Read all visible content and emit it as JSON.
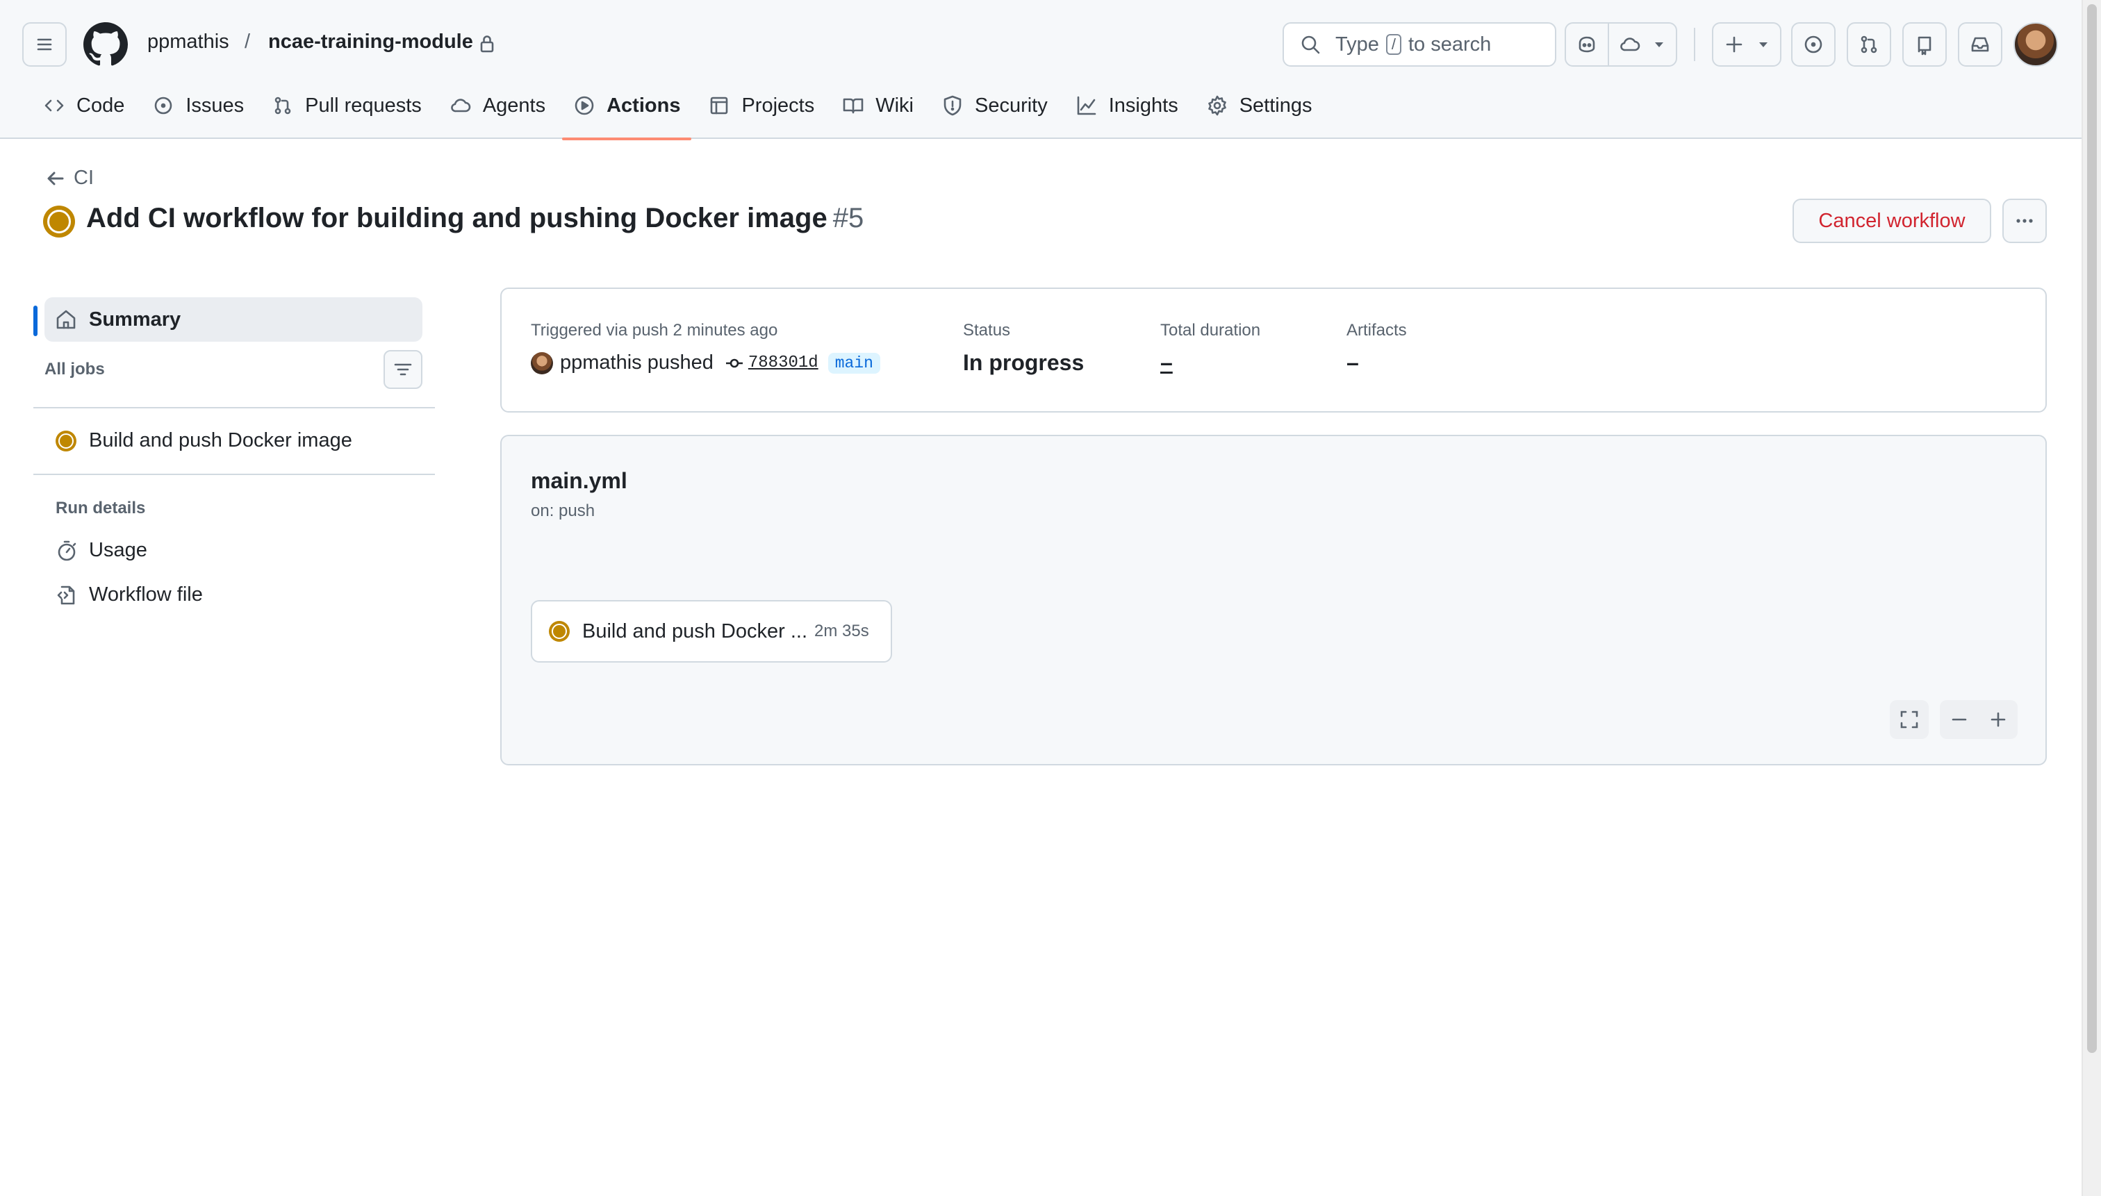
{
  "header": {
    "owner": "ppmathis",
    "separator": "/",
    "repo": "ncae-training-module",
    "search": {
      "prefix": "Type",
      "key": "/",
      "suffix": "to search"
    },
    "icons": [
      "hamburger-icon",
      "github-logo-icon",
      "lock-icon",
      "search-icon",
      "copilot-icon",
      "agents-cloud-icon",
      "plus-icon",
      "issues-icon",
      "pull-requests-icon",
      "repos-icon",
      "inbox-icon"
    ]
  },
  "tabs": [
    {
      "label": "Code",
      "icon": "code-icon"
    },
    {
      "label": "Issues",
      "icon": "issue-icon"
    },
    {
      "label": "Pull requests",
      "icon": "pull-request-icon"
    },
    {
      "label": "Agents",
      "icon": "agents-icon"
    },
    {
      "label": "Actions",
      "icon": "play-icon",
      "selected": true
    },
    {
      "label": "Projects",
      "icon": "table-icon"
    },
    {
      "label": "Wiki",
      "icon": "book-icon"
    },
    {
      "label": "Security",
      "icon": "shield-icon"
    },
    {
      "label": "Insights",
      "icon": "graph-icon"
    },
    {
      "label": "Settings",
      "icon": "gear-icon"
    }
  ],
  "run": {
    "back_label": "CI",
    "title": "Add CI workflow for building and pushing Docker image",
    "number": "#5",
    "cancel_label": "Cancel workflow",
    "status_color": "#bf8700"
  },
  "sidebar": {
    "summary": "Summary",
    "all_jobs": "All jobs",
    "jobs": [
      "Build and push Docker image"
    ],
    "run_details": "Run details",
    "links": [
      "Usage",
      "Workflow file"
    ]
  },
  "summary": {
    "trigger": "Triggered via push 2 minutes ago",
    "pusher": "ppmathis pushed",
    "commit": "788301d",
    "branch": "main",
    "status_label": "Status",
    "status_value": "In progress",
    "duration_label": "Total duration",
    "duration_value": "–",
    "artifacts_label": "Artifacts",
    "artifacts_value": "–"
  },
  "workflow": {
    "file": "main.yml",
    "trigger": "on: push",
    "job_name": "Build and push Docker ...",
    "job_duration": "2m 35s"
  }
}
